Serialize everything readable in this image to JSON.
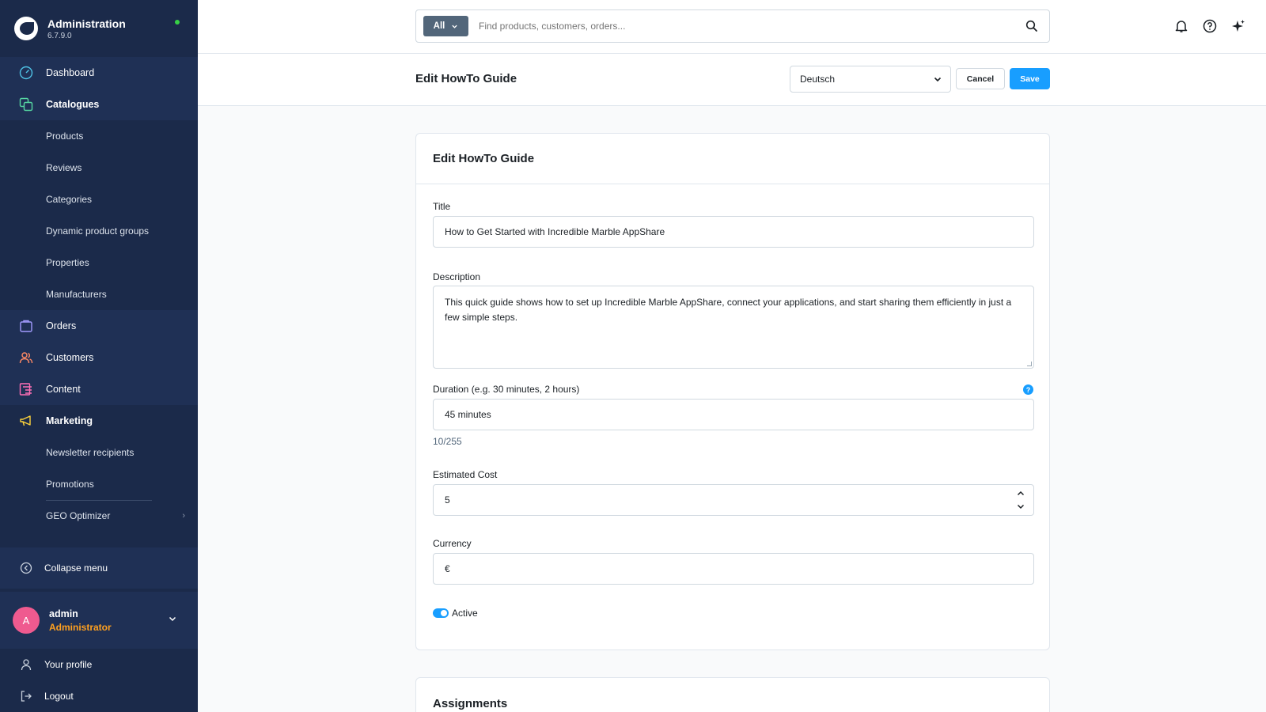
{
  "app": {
    "title": "Administration",
    "version": "6.7.9.0"
  },
  "sidebar": {
    "items": [
      {
        "label": "Dashboard"
      },
      {
        "label": "Catalogues"
      },
      {
        "label": "Products"
      },
      {
        "label": "Reviews"
      },
      {
        "label": "Categories"
      },
      {
        "label": "Dynamic product groups"
      },
      {
        "label": "Properties"
      },
      {
        "label": "Manufacturers"
      },
      {
        "label": "Orders"
      },
      {
        "label": "Customers"
      },
      {
        "label": "Content"
      },
      {
        "label": "Marketing"
      },
      {
        "label": "Newsletter recipients"
      },
      {
        "label": "Promotions"
      },
      {
        "label": "GEO Optimizer"
      }
    ],
    "collapse_label": "Collapse menu",
    "user": {
      "initial": "A",
      "name": "admin",
      "role": "Administrator"
    },
    "profile_label": "Your profile",
    "logout_label": "Logout"
  },
  "search": {
    "filter_label": "All",
    "placeholder": "Find products, customers, orders..."
  },
  "header": {
    "title": "Edit HowTo Guide",
    "language": "Deutsch",
    "cancel_label": "Cancel",
    "save_label": "Save"
  },
  "form": {
    "card_title": "Edit HowTo Guide",
    "title_label": "Title",
    "title_value": "How to Get Started with Incredible Marble AppShare",
    "description_label": "Description",
    "description_value": "This quick guide shows how to set up Incredible Marble AppShare, connect your applications, and start sharing them efficiently in just a few simple steps.",
    "duration_label": "Duration (e.g. 30 minutes, 2 hours)",
    "duration_value": "45 minutes",
    "duration_counter": "10/255",
    "cost_label": "Estimated Cost",
    "cost_value": "5",
    "currency_label": "Currency",
    "currency_value": "€",
    "active_label": "Active",
    "help_glyph": "?"
  },
  "assignments": {
    "title": "Assignments"
  },
  "colors": {
    "sidebar": "#1b2a4a",
    "primary": "#189eff",
    "role": "#ffa01f",
    "avatar": "#ef5a8f"
  }
}
